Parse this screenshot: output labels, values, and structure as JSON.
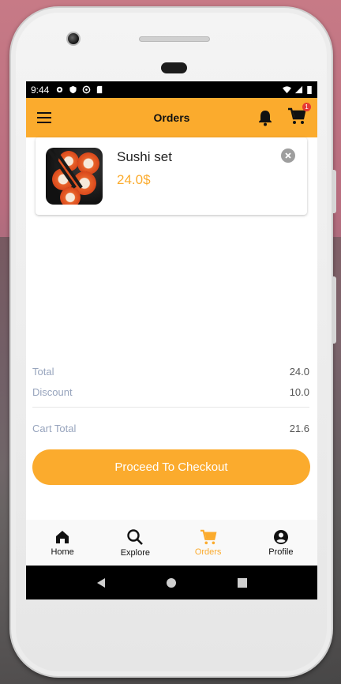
{
  "status_bar": {
    "time": "9:44"
  },
  "app_bar": {
    "title": "Orders",
    "cart_badge": "1"
  },
  "cart_items": [
    {
      "name": "Sushi set",
      "price": "24.0$"
    }
  ],
  "summary": {
    "total_label": "Total",
    "total_value": "24.0",
    "discount_label": "Discount",
    "discount_value": "10.0",
    "cart_total_label": "Cart Total",
    "cart_total_value": "21.6"
  },
  "checkout_label": "Proceed To Checkout",
  "bottom_nav": [
    {
      "label": "Home",
      "icon": "home-icon"
    },
    {
      "label": "Explore",
      "icon": "search-icon"
    },
    {
      "label": "Orders",
      "icon": "cart-icon",
      "active": true
    },
    {
      "label": "Profile",
      "icon": "account-icon"
    }
  ],
  "colors": {
    "accent": "#fbab2d",
    "badge": "#e53935",
    "label": "#97a4bd"
  }
}
